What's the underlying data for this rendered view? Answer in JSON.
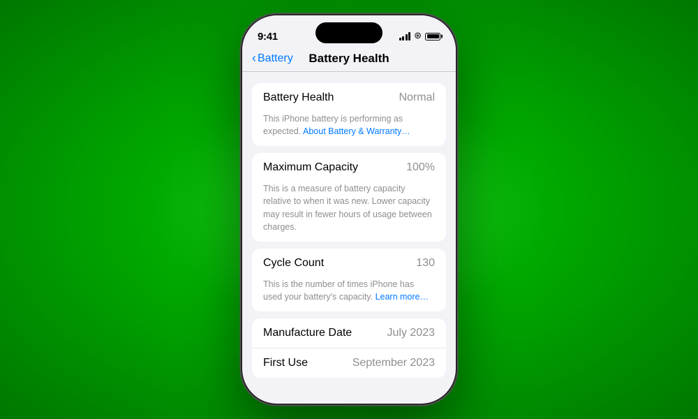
{
  "background": {
    "gradient_center": "#22dd22",
    "gradient_mid": "#00aa00",
    "gradient_edge": "#007700"
  },
  "status_bar": {
    "time": "9:41",
    "signal_label": "signal",
    "wifi_label": "wifi",
    "battery_label": "battery"
  },
  "nav": {
    "back_label": "Battery",
    "title": "Battery Health"
  },
  "sections": [
    {
      "id": "battery-health-section",
      "rows": [
        {
          "label": "Battery Health",
          "value": "Normal"
        }
      ],
      "description_main": "This iPhone battery is performing as expected. ",
      "description_link": "About Battery & Warranty…",
      "description_link_href": "#"
    },
    {
      "id": "max-capacity-section",
      "rows": [
        {
          "label": "Maximum Capacity",
          "value": "100%"
        }
      ],
      "description_main": "This is a measure of battery capacity relative to when it was new. Lower capacity may result in fewer hours of usage between charges.",
      "description_link": null
    },
    {
      "id": "cycle-count-section",
      "rows": [
        {
          "label": "Cycle Count",
          "value": "130"
        }
      ],
      "description_main": "This is the number of times iPhone has used your battery's capacity. ",
      "description_link": "Learn more…",
      "description_link_href": "#"
    },
    {
      "id": "dates-section",
      "rows": [
        {
          "label": "Manufacture Date",
          "value": "July 2023"
        },
        {
          "label": "First Use",
          "value": "September 2023"
        }
      ],
      "description_main": null,
      "description_link": null
    }
  ]
}
